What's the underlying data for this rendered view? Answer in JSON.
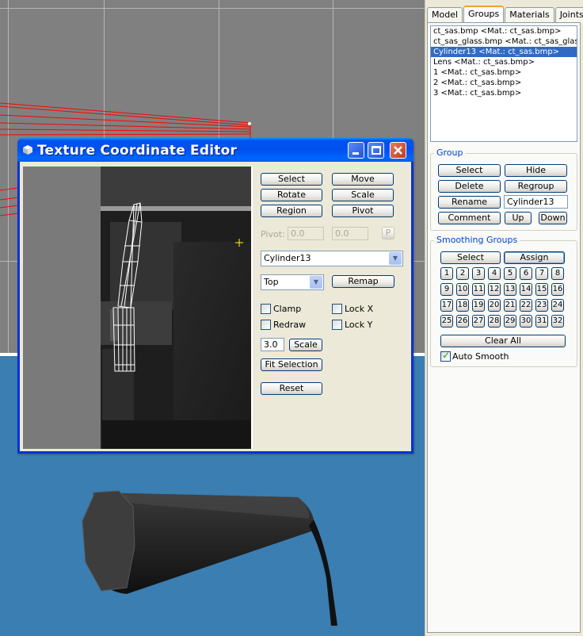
{
  "tabs": [
    {
      "label": "Model",
      "active": false
    },
    {
      "label": "Groups",
      "active": true
    },
    {
      "label": "Materials",
      "active": false
    },
    {
      "label": "Joints",
      "active": false
    }
  ],
  "group_list": [
    {
      "label": "ct_sas.bmp <Mat.: ct_sas.bmp>",
      "selected": false
    },
    {
      "label": "ct_sas_glass.bmp <Mat.: ct_sas_glass",
      "selected": false
    },
    {
      "label": "Cylinder13 <Mat.: ct_sas.bmp>",
      "selected": true
    },
    {
      "label": "Lens <Mat.: ct_sas.bmp>",
      "selected": false
    },
    {
      "label": "1 <Mat.: ct_sas.bmp>",
      "selected": false
    },
    {
      "label": "2 <Mat.: ct_sas.bmp>",
      "selected": false
    },
    {
      "label": "3 <Mat.: ct_sas.bmp>",
      "selected": false
    }
  ],
  "group_section": {
    "legend": "Group",
    "select": "Select",
    "hide": "Hide",
    "delete": "Delete",
    "regroup": "Regroup",
    "rename": "Rename",
    "name_value": "Cylinder13",
    "comment": "Comment",
    "up": "Up",
    "down": "Down"
  },
  "smoothing": {
    "legend": "Smoothing Groups",
    "select": "Select",
    "assign": "Assign",
    "numbers": [
      "1",
      "2",
      "3",
      "4",
      "5",
      "6",
      "7",
      "8",
      "9",
      "10",
      "11",
      "12",
      "13",
      "14",
      "15",
      "16",
      "17",
      "18",
      "19",
      "20",
      "21",
      "22",
      "23",
      "24",
      "25",
      "26",
      "27",
      "28",
      "29",
      "30",
      "31",
      "32"
    ],
    "clear_all": "Clear All",
    "auto_smooth": "Auto Smooth",
    "auto_smooth_checked": true
  },
  "tce": {
    "title": "Texture Coordinate Editor",
    "select": "Select",
    "move": "Move",
    "rotate": "Rotate",
    "scale": "Scale",
    "region": "Region",
    "pivot": "Pivot",
    "pivot_label": "Pivot:",
    "pivot_x": "0.0",
    "pivot_y": "0.0",
    "pivot_p": "P",
    "model_select": "Cylinder13",
    "view_select": "Top",
    "remap": "Remap",
    "clamp": "Clamp",
    "lock_x": "Lock X",
    "redraw": "Redraw",
    "lock_y": "Lock Y",
    "scale_value": "3.0",
    "scale_button": "Scale",
    "fit_selection": "Fit Selection",
    "reset": "Reset"
  },
  "colors": {
    "viewport_bg": "#3a7eb2",
    "xp_title_blue": "#0053ee",
    "selection_blue": "#316ac5",
    "wireframe_red": "#ff0000"
  }
}
